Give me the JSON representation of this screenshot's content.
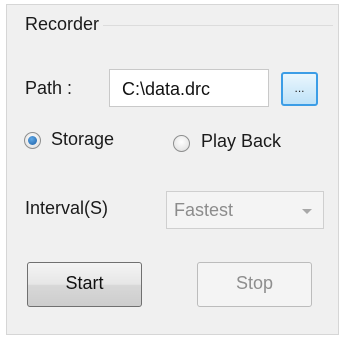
{
  "recorder": {
    "title": "Recorder",
    "path_label": "Path :",
    "path_value": "C:\\data.drc",
    "browse_label": "...",
    "mode": {
      "options": [
        "Storage",
        "Play Back"
      ],
      "selected": "Storage"
    },
    "interval_label": "Interval(S)",
    "interval_value": "Fastest",
    "start_label": "Start",
    "stop_label": "Stop"
  },
  "colors": {
    "panel_bg": "#f0f0f0",
    "accent": "#3c9de6",
    "disabled_text": "#8e8e8e"
  }
}
